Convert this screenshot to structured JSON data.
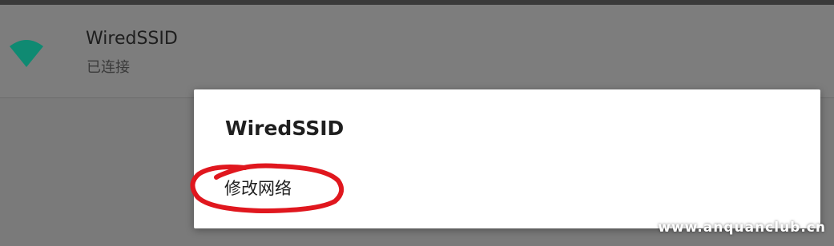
{
  "network": {
    "ssid": "WiredSSID",
    "status": "已连接",
    "icon": "wifi-icon",
    "icon_color": "#0f8a72"
  },
  "dialog": {
    "title": "WiredSSID",
    "menu_items": [
      "修改网络"
    ]
  },
  "annotation": {
    "color": "#e0171e"
  },
  "watermark": "www.anquanclub.cn"
}
